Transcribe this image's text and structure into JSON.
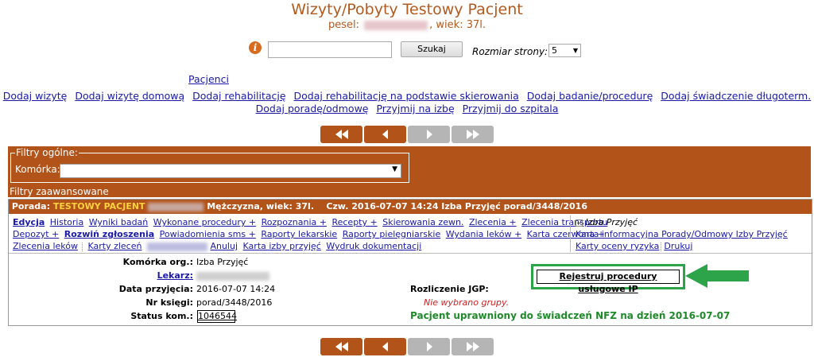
{
  "header": {
    "title": "Wizyty/Pobyty Testowy Pacjent",
    "pesel_label": "pesel:",
    "age_text": ", wiek: 37l."
  },
  "search": {
    "info_icon": "i",
    "button_label": "Szukaj",
    "page_size_label": "Rozmiar strony:",
    "page_size_value": "5"
  },
  "links": {
    "patients": "Pacjenci",
    "row1": [
      "Dodaj wizytę",
      "Dodaj wizytę domową",
      "Dodaj rehabilitację",
      "Dodaj rehabilitację na podstawie skierowania",
      "Dodaj badanie/procedurę",
      "Dodaj świadczenie długoterm."
    ],
    "row2": [
      "Dodaj poradę/odmowę",
      "Przyjmij na izbę",
      "Przyjmij do szpitala"
    ]
  },
  "filters": {
    "general_legend": "Filtry ogólne:",
    "komorka_label": "Komórka:",
    "advanced_label": "Filtry zaawansowane"
  },
  "card": {
    "head_prefix": "Porada:",
    "patient_name": "TESTOWY PACJENT",
    "patient_info": "Mężczyzna, wiek: 37l.",
    "visit_info": "Czw.  2016-07-07 14:24 Izba Przyjęć porad/3448/2016",
    "menu1": [
      "Edycja",
      "Historia",
      "Wyniki badań",
      "Wykonane procedury +",
      "Rozpoznania +",
      "Recepty +",
      "Skierowania zewn.",
      "Zlecenia +",
      "Zlecenia transportu"
    ],
    "menu2": [
      "Depozyt +",
      "Rozwiń zgłoszenia",
      "Powiadomienia sms +",
      "Raporty lekarskie",
      "Raporty pielęgniarskie",
      "Wydania leków +",
      "Karta czerwona +"
    ],
    "menu3": [
      "Zlecenia leków",
      "Karty zleceń",
      "Wydruk dokumentacji"
    ],
    "menu3_anuluj": "Anuluj",
    "menu3_izba": "Karta izby przyjęć",
    "right_title": "Izba Przyjęć",
    "right_link1": "Karta informacyjna Porady/Odmowy Izby Przyjęć",
    "right_link2": "Karty oceny ryzyka",
    "right_link3": "Drukuj",
    "fields": {
      "komorka_label": "Komórka org.:",
      "komorka_value": "Izba Przyjęć",
      "lekarz_label": "Lekarz:",
      "data_label": "Data przyjęcia:",
      "data_value": "2016-07-07 14:24",
      "nr_label": "Nr księgi:",
      "nr_value": "porad/3448/2016",
      "status_label": "Status kom.:",
      "status_value": "1046544",
      "jgp_label": "Rozliczenie JGP:",
      "jgp_value": "Nie wybrano grupy.",
      "nfz_text": "Pacjent uprawniony do świadczeń NFZ na dzień 2016-07-07",
      "register_button": "Rejestruj procedury usługowe IP"
    }
  },
  "colors": {
    "brand": "#b25319",
    "title": "#b35a1f",
    "highlight_green": "#2ea44a",
    "patient_name": "#ffd23f"
  }
}
